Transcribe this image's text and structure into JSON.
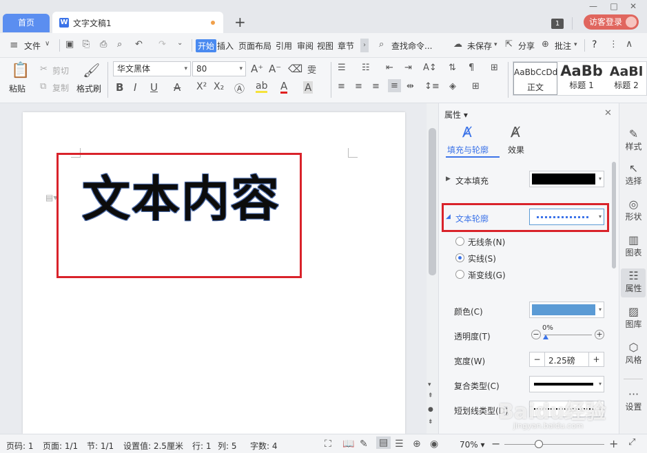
{
  "tabs": {
    "home": "首页",
    "doc_title": "文字文稿1",
    "doc_icon": "W",
    "new_tab": "+"
  },
  "window": {
    "badge": "1",
    "login": "访客登录",
    "min": "—",
    "max": "□",
    "close": "✕"
  },
  "menu": {
    "file": "文件",
    "items": [
      "开始",
      "插入",
      "页面布局",
      "引用",
      "审阅",
      "视图",
      "章节"
    ],
    "search": "查找命令...",
    "unsaved": "未保存",
    "share": "分享",
    "comment": "批注",
    "help": "?"
  },
  "ribbon": {
    "paste": "粘贴",
    "cut": "剪切",
    "copy": "复制",
    "format_painter": "格式刷",
    "font_name": "华文黑体",
    "font_size": "80",
    "styles": [
      {
        "preview": "AaBbCcDd",
        "label": "正文"
      },
      {
        "preview": "AaBb",
        "label": "标题 1"
      },
      {
        "preview": "AaBl",
        "label": "标题 2"
      }
    ]
  },
  "document": {
    "content": "文本内容"
  },
  "panel": {
    "title": "属性",
    "tab_fill": "填充与轮廓",
    "tab_effect": "效果",
    "text_fill": "文本填充",
    "text_outline": "文本轮廓",
    "options": [
      "无线条(N)",
      "实线(S)",
      "渐变线(G)"
    ],
    "selected_option": 1,
    "color_label": "颜色(C)",
    "transparency_label": "透明度(T)",
    "transparency_value": "0%",
    "width_label": "宽度(W)",
    "width_value": "2.25磅",
    "compound_label": "复合类型(C)",
    "dash_label": "短划线类型(D)",
    "fill_color": "#000000",
    "outline_color": "#5b9bd5"
  },
  "right_toolbar": [
    "样式",
    "选择",
    "形状",
    "图表",
    "属性",
    "图库",
    "风格",
    "设置"
  ],
  "status": {
    "page": "页码: 1",
    "pages": "页面: 1/1",
    "section": "节: 1/1",
    "setting": "设置值: 2.5厘米",
    "row": "行: 1",
    "col": "列: 5",
    "words": "字数: 4",
    "zoom": "70%"
  },
  "watermark": {
    "text": "Baidu经验",
    "url": "jingyan.baidu.com"
  }
}
